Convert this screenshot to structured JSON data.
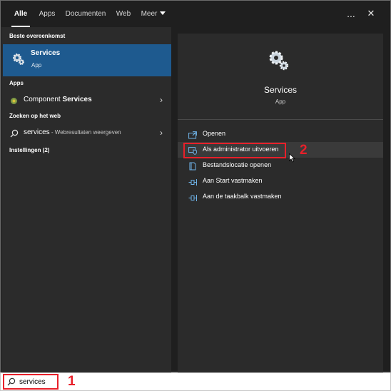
{
  "tabs": [
    {
      "label": "Alle",
      "active": true
    },
    {
      "label": "Apps",
      "active": false
    },
    {
      "label": "Documenten",
      "active": false
    },
    {
      "label": "Web",
      "active": false
    },
    {
      "label": "Meer",
      "active": false
    }
  ],
  "top_icons": {
    "more": "...",
    "close": "✕"
  },
  "left": {
    "best_match_header": "Beste overeenkomst",
    "best_match": {
      "title": "Services",
      "subtitle": "App",
      "icon": "gear-icon"
    },
    "apps_header": "Apps",
    "apps": [
      {
        "prefix": "Component ",
        "highlight": "Services",
        "icon": "component-services-icon"
      }
    ],
    "web_header": "Zoeken op het web",
    "web": [
      {
        "query": "services",
        "suffix": " - Webresultaten weergeven",
        "icon": "search-icon"
      }
    ],
    "settings_header": "Instellingen (2)"
  },
  "preview": {
    "title": "Services",
    "subtitle": "App",
    "actions": [
      {
        "label": "Openen",
        "icon": "open-icon"
      },
      {
        "label": "Als administrator uitvoeren",
        "icon": "shield-icon"
      },
      {
        "label": "Bestandslocatie openen",
        "icon": "file-location-icon"
      },
      {
        "label": "Aan Start vastmaken",
        "icon": "pin-icon"
      },
      {
        "label": "Aan de taakbalk vastmaken",
        "icon": "pin-icon"
      }
    ]
  },
  "annotations": {
    "step1": "1",
    "step2": "2"
  },
  "search": {
    "value": "services"
  },
  "colors": {
    "accent": "#1e5a8f",
    "annotation": "#e8202a",
    "panel": "#2b2b2b",
    "background": "#1f1f1f"
  }
}
